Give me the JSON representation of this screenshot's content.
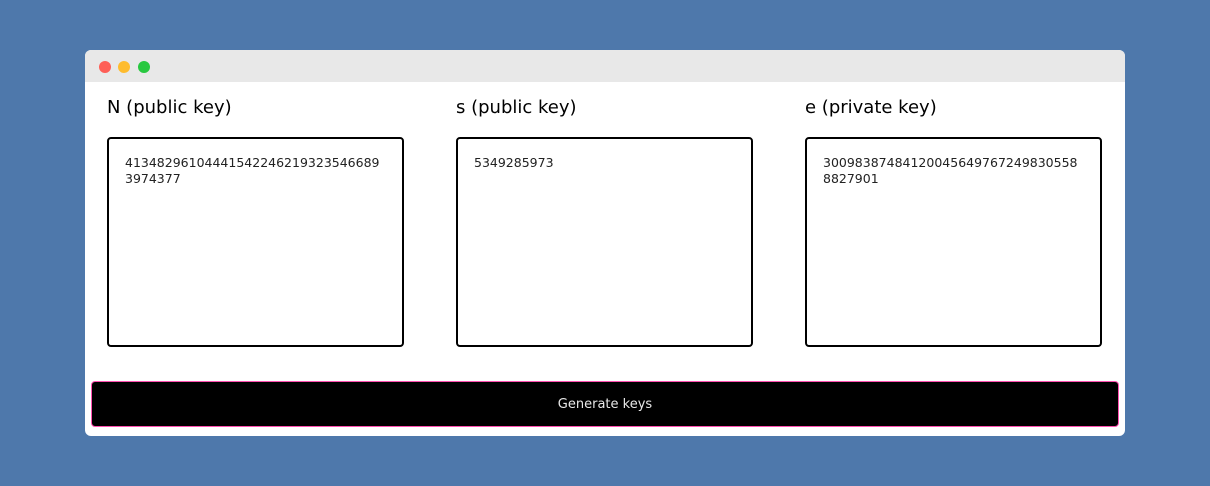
{
  "window": {
    "controls": [
      "close",
      "minimize",
      "maximize"
    ]
  },
  "keys": {
    "n": {
      "label": "N (public key)",
      "value": "41348296104441542246219323546689397437​7"
    },
    "s": {
      "label": "s (public key)",
      "value": "5349285973"
    },
    "e": {
      "label": "e (private key)",
      "value": "30098387484120045649767249830558882790​1"
    }
  },
  "actions": {
    "generate_label": "Generate keys"
  },
  "colors": {
    "background": "#4e78ab",
    "titlebar": "#e8e8e8",
    "button_bg": "#000000",
    "button_border": "#ff4fb0",
    "close": "#fe5f57",
    "minimize": "#febc2e",
    "maximize": "#28c840"
  }
}
